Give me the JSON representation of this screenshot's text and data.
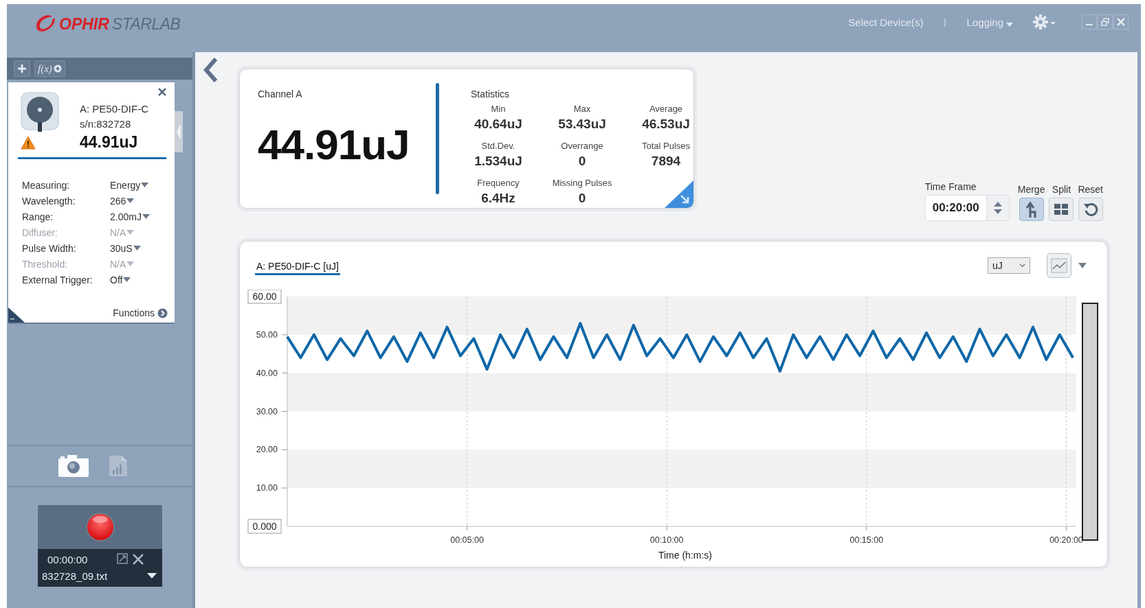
{
  "app": {
    "logo_brand": "OPHIR",
    "logo_product": "STARLAB"
  },
  "top_menu": [
    {
      "label": "Select Device(s)",
      "kind": "link"
    },
    {
      "label": "|",
      "kind": "separator"
    },
    {
      "label": "Logging",
      "kind": "dropdown"
    }
  ],
  "sidebar": {
    "function_button": "f(x)",
    "device": {
      "name": "A: PE50-DIF-C",
      "serial": "s/n:832728",
      "reading": "44.91uJ",
      "warning": true
    },
    "settings": [
      {
        "label": "Measuring:",
        "value": "Energy",
        "disabled": false
      },
      {
        "label": "Wavelength:",
        "value": "266",
        "disabled": false
      },
      {
        "label": "Range:",
        "value": "2.00mJ",
        "disabled": false
      },
      {
        "label": "Diffuser:",
        "value": "N/A",
        "disabled": true
      },
      {
        "label": "Pulse Width:",
        "value": "30uS",
        "disabled": false
      },
      {
        "label": "Threshold:",
        "value": "N/A",
        "disabled": true
      },
      {
        "label": "External Trigger:",
        "value": "Off",
        "disabled": false
      }
    ],
    "functions_link": "Functions",
    "recorder": {
      "time": "00:00:00",
      "file": "832728_09.txt"
    }
  },
  "channel": {
    "title": "Channel A",
    "reading": "44.91uJ"
  },
  "statistics": {
    "title": "Statistics",
    "items": [
      {
        "label": "Min",
        "value": "40.64uJ"
      },
      {
        "label": "Max",
        "value": "53.43uJ"
      },
      {
        "label": "Average",
        "value": "46.53uJ"
      },
      {
        "label": "Std.Dev.",
        "value": "1.534uJ"
      },
      {
        "label": "Overrange",
        "value": "0"
      },
      {
        "label": "Total Pulses",
        "value": "7894"
      },
      {
        "label": "Frequency",
        "value": "6.4Hz"
      },
      {
        "label": "Missing Pulses",
        "value": "0"
      }
    ]
  },
  "time_frame": {
    "label": "Time Frame",
    "value": "00:20:00"
  },
  "view_buttons": [
    {
      "label": "Merge",
      "kind": "merge",
      "selected": true
    },
    {
      "label": "Split",
      "kind": "split",
      "selected": false
    },
    {
      "label": "Reset",
      "kind": "reset",
      "selected": false
    }
  ],
  "chart": {
    "tab": "A: PE50-DIF-C [uJ]",
    "unit_select": "uJ",
    "chart_data": {
      "type": "line",
      "grid": true,
      "xlabel": "Time (h:m:s)",
      "xlim": [
        30,
        1215
      ],
      "ylim": [
        0,
        60
      ],
      "xticks": [
        {
          "value": 300,
          "label": "00:05:00"
        },
        {
          "value": 600,
          "label": "00:10:00"
        },
        {
          "value": 900,
          "label": "00:15:00"
        },
        {
          "value": 1200,
          "label": "00:20:00"
        }
      ],
      "yticks": [
        {
          "value": 0,
          "label": "0.000"
        },
        {
          "value": 10,
          "label": "10.00"
        },
        {
          "value": 20,
          "label": "20.00"
        },
        {
          "value": 30,
          "label": "30.00"
        },
        {
          "value": 40,
          "label": "40.00"
        },
        {
          "value": 50,
          "label": "50.00"
        },
        {
          "value": 60,
          "label": "60.00"
        }
      ],
      "x": [
        30,
        50,
        70,
        90,
        110,
        130,
        150,
        170,
        190,
        210,
        230,
        250,
        270,
        290,
        310,
        330,
        350,
        370,
        390,
        410,
        430,
        450,
        470,
        490,
        510,
        530,
        550,
        570,
        590,
        610,
        630,
        650,
        670,
        690,
        710,
        730,
        750,
        770,
        790,
        810,
        830,
        850,
        870,
        890,
        910,
        930,
        950,
        970,
        990,
        1010,
        1030,
        1050,
        1070,
        1090,
        1110,
        1130,
        1150,
        1170,
        1190,
        1210
      ],
      "series": [
        {
          "color": "#0f67a8",
          "values": [
            49.5,
            44,
            50,
            43.5,
            49,
            44.5,
            51,
            44,
            49.5,
            43,
            50.5,
            44,
            52,
            44.5,
            49,
            41,
            50,
            44,
            51.5,
            43.5,
            49.5,
            44,
            53,
            44,
            50,
            43.5,
            52.5,
            44.5,
            49,
            44,
            50,
            43,
            49.5,
            44.5,
            50.5,
            44,
            49,
            40.5,
            50,
            44,
            49.5,
            43.5,
            50,
            44.5,
            51,
            44,
            49,
            43.5,
            50.5,
            44,
            49.5,
            43,
            51.5,
            44.5,
            50,
            44,
            52,
            43.5,
            50,
            44
          ]
        }
      ]
    }
  }
}
